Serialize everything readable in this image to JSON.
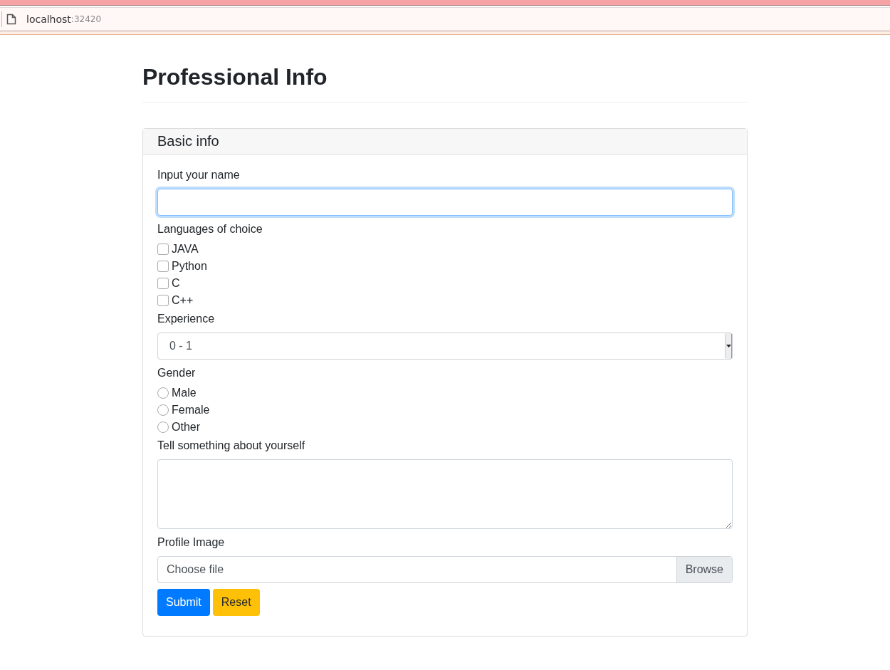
{
  "browser": {
    "host": "localhost",
    "port": ":32420"
  },
  "page": {
    "title": "Professional Info"
  },
  "card": {
    "header": "Basic info",
    "name_field": {
      "label": "Input your name",
      "focused": true
    },
    "languages": {
      "label": "Languages of choice",
      "options": [
        {
          "label": "JAVA",
          "checked": false
        },
        {
          "label": "Python",
          "checked": false
        },
        {
          "label": "C",
          "checked": false
        },
        {
          "label": "C++",
          "checked": false
        }
      ]
    },
    "experience": {
      "label": "Experience",
      "value": "0 - 1"
    },
    "gender": {
      "label": "Gender",
      "options": [
        {
          "label": "Male",
          "selected": false
        },
        {
          "label": "Female",
          "selected": false
        },
        {
          "label": "Other",
          "selected": false
        }
      ]
    },
    "about": {
      "label": "Tell something about yourself"
    },
    "profile_image": {
      "label": "Profile Image",
      "placeholder": "Choose file",
      "button": "Browse"
    },
    "buttons": [
      {
        "label": "Submit",
        "kind": "primary"
      },
      {
        "label": "Reset",
        "kind": "warning"
      }
    ]
  }
}
